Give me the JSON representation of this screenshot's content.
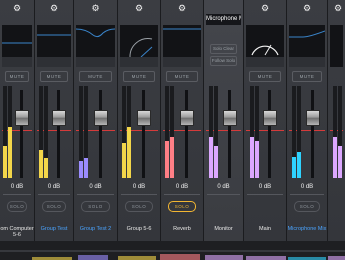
{
  "accent_colors": {
    "yellow": "#f3d64a",
    "blue": "#45b5ff",
    "purple": "#9b8cff",
    "orange": "#ffb24a",
    "red": "#ff7f86",
    "violet": "#dca7ff",
    "pink": "#ff9fe0",
    "cyan": "#2fd3ff",
    "magenta": "#f08cff"
  },
  "common": {
    "mute_label": "MUTE",
    "solo_label": "SOLO",
    "gain_value": "0 dB"
  },
  "strips": [
    {
      "name": "om Computer",
      "name2": "5-6",
      "solo_on": false,
      "meters": [
        0.35,
        0.55
      ],
      "color": "#f3d64a"
    },
    {
      "name": "Group Test",
      "name2": "",
      "solo_on": false,
      "meters": [
        0.3,
        0.22
      ],
      "color": "#f3d64a",
      "name_blue": true
    },
    {
      "name": "Group Test 2",
      "name2": "",
      "solo_on": false,
      "meters": [
        0.18,
        0.22
      ],
      "color": "#9b8cff",
      "name_blue": true
    },
    {
      "name": "Group 5-6",
      "name2": "",
      "solo_on": false,
      "meters": [
        0.38,
        0.55
      ],
      "color": "#f3d64a"
    },
    {
      "name": "Reverb",
      "name2": "",
      "solo_on": true,
      "meters": [
        0.4,
        0.45
      ],
      "color": "#ff7f86"
    },
    {
      "name": "Monitor",
      "name2": "",
      "title": "Microphone Mix",
      "solo_on": false,
      "meters": [
        0.45,
        0.35
      ],
      "color": "#dca7ff",
      "buttons": [
        "Solo Clear",
        "Follow Solo"
      ]
    },
    {
      "name": "Main",
      "name2": "",
      "solo_on": false,
      "meters": [
        0.45,
        0.4
      ],
      "color": "#dca7ff"
    },
    {
      "name": "Microphone Mix",
      "name2": "",
      "solo_on": false,
      "meters": [
        0.23,
        0.28
      ],
      "color": "#2fd3ff",
      "name_blue": true
    },
    {
      "name": "Line Mix",
      "name2": "",
      "solo_on": false,
      "meters": [
        0.45,
        0.35
      ],
      "color": "#dca7ff"
    }
  ]
}
